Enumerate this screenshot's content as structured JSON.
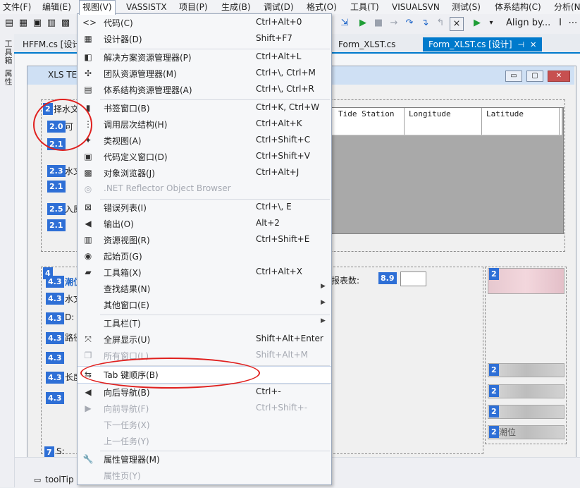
{
  "menubar": {
    "items": [
      "文件(F)",
      "编辑(E)",
      "视图(V)",
      "VASSISTX",
      "项目(P)",
      "生成(B)",
      "调试(D)",
      "格式(O)",
      "工具(T)",
      "VISUALSVN",
      "测试(S)",
      "体系结构(C)",
      "分析(N"
    ]
  },
  "toolbar": {
    "align_label": "Align by...",
    "cursor_glyph": "I"
  },
  "left_strip": {
    "items": [
      "工具箱",
      "属性"
    ]
  },
  "doc_tabs": {
    "items": [
      {
        "label": "HFFM.cs [设计]"
      },
      {
        "label": "Form_XLST.cs"
      },
      {
        "label": "Form_XLST.cs [设计]",
        "pin": "⊣",
        "close": "✕"
      }
    ]
  },
  "form": {
    "title": "XLS TE",
    "window_buttons": {
      "minimize": "▭",
      "maximize": "▢",
      "close": "✕"
    },
    "labels": {
      "l1": "择水文",
      "l2": "可",
      "l3": "水文",
      "l4": "入原",
      "l5": "潮位",
      "l6": "水文",
      "l7": "D:",
      "l8": "路径",
      "l9": "长度",
      "l10": "S:",
      "count_label": "报表数:",
      "lower_btn_text": "潮位"
    },
    "tab_badges": [
      "2",
      "2.0",
      "2.1",
      "2.3",
      "2.1",
      "2.5",
      "2.1",
      "4",
      "4.3",
      "4.3",
      "4.3",
      "4.3",
      "4.3",
      "4.3",
      "4.3",
      "8.9",
      "7",
      "2",
      "2",
      "2",
      "2",
      "2"
    ],
    "grid": {
      "columns": [
        "Tide Station",
        "Longitude",
        "Latitude"
      ]
    },
    "component_tray": {
      "item": "toolTip"
    }
  },
  "view_menu": {
    "items": [
      {
        "icon": "code-icon",
        "glyph": "<>",
        "label": "代码(C)",
        "shortcut": "Ctrl+Alt+0",
        "disabled": false
      },
      {
        "icon": "designer-icon",
        "glyph": "▦",
        "label": "设计器(D)",
        "shortcut": "Shift+F7",
        "disabled": false
      },
      {
        "sep": true
      },
      {
        "icon": "solution-explorer-icon",
        "glyph": "◧",
        "label": "解决方案资源管理器(P)",
        "shortcut": "Ctrl+Alt+L",
        "disabled": false
      },
      {
        "icon": "team-explorer-icon",
        "glyph": "✣",
        "label": "团队资源管理器(M)",
        "shortcut": "Ctrl+\\, Ctrl+M",
        "disabled": false
      },
      {
        "icon": "architecture-explorer-icon",
        "glyph": "▤",
        "label": "体系结构资源管理器(A)",
        "shortcut": "Ctrl+\\, Ctrl+R",
        "disabled": false
      },
      {
        "sep": true
      },
      {
        "icon": "bookmark-icon",
        "glyph": "▮",
        "label": "书签窗口(B)",
        "shortcut": "Ctrl+K, Ctrl+W",
        "disabled": false
      },
      {
        "icon": "call-hierarchy-icon",
        "glyph": "⋮",
        "label": "调用层次结构(H)",
        "shortcut": "Ctrl+Alt+K",
        "disabled": false
      },
      {
        "icon": "class-view-icon",
        "glyph": "✦",
        "label": "类视图(A)",
        "shortcut": "Ctrl+Shift+C",
        "disabled": false
      },
      {
        "icon": "code-definition-icon",
        "glyph": "▣",
        "label": "代码定义窗口(D)",
        "shortcut": "Ctrl+Shift+V",
        "disabled": false
      },
      {
        "icon": "object-browser-icon",
        "glyph": "▩",
        "label": "对象浏览器(J)",
        "shortcut": "Ctrl+Alt+J",
        "disabled": false
      },
      {
        "icon": "reflector-icon",
        "glyph": "◎",
        "label": ".NET Reflector Object Browser",
        "shortcut": "",
        "disabled": true
      },
      {
        "sep": true
      },
      {
        "icon": "error-list-icon",
        "glyph": "⊠",
        "label": "错误列表(I)",
        "shortcut": "Ctrl+\\, E",
        "disabled": false
      },
      {
        "icon": "output-icon",
        "glyph": "◀",
        "label": "输出(O)",
        "shortcut": "Alt+2",
        "disabled": false
      },
      {
        "icon": "resource-view-icon",
        "glyph": "▥",
        "label": "资源视图(R)",
        "shortcut": "Ctrl+Shift+E",
        "disabled": false
      },
      {
        "icon": "start-page-icon",
        "glyph": "◉",
        "label": "起始页(G)",
        "shortcut": "",
        "disabled": false
      },
      {
        "icon": "toolbox-icon",
        "glyph": "▰",
        "label": "工具箱(X)",
        "shortcut": "Ctrl+Alt+X",
        "disabled": false
      },
      {
        "icon": "find-results-icon",
        "glyph": "",
        "label": "查找结果(N)",
        "shortcut": "",
        "disabled": false,
        "submenu": true
      },
      {
        "icon": "other-windows-icon",
        "glyph": "",
        "label": "其他窗口(E)",
        "shortcut": "",
        "disabled": false,
        "submenu": true
      },
      {
        "sep": true
      },
      {
        "icon": "toolbars-icon",
        "glyph": "",
        "label": "工具栏(T)",
        "shortcut": "",
        "disabled": false,
        "submenu": true
      },
      {
        "icon": "full-screen-icon",
        "glyph": "⤧",
        "label": "全屏显示(U)",
        "shortcut": "Shift+Alt+Enter",
        "disabled": false
      },
      {
        "icon": "all-windows-icon",
        "glyph": "❐",
        "label": "所有窗口(L)",
        "shortcut": "Shift+Alt+M",
        "disabled": true
      },
      {
        "sep": true
      },
      {
        "icon": "tab-order-icon",
        "glyph": "⇆",
        "label": "Tab 键顺序(B)",
        "shortcut": "",
        "disabled": false,
        "highlight": true
      },
      {
        "sep": true
      },
      {
        "icon": "navigate-back-icon",
        "glyph": "◀",
        "label": "向后导航(B)",
        "shortcut": "Ctrl+-",
        "disabled": false
      },
      {
        "icon": "navigate-forward-icon",
        "glyph": "▶",
        "label": "向前导航(F)",
        "shortcut": "Ctrl+Shift+-",
        "disabled": true
      },
      {
        "icon": "next-task-icon",
        "glyph": "",
        "label": "下一任务(X)",
        "shortcut": "",
        "disabled": true
      },
      {
        "icon": "previous-task-icon",
        "glyph": "",
        "label": "上一任务(Y)",
        "shortcut": "",
        "disabled": true
      },
      {
        "sep": true
      },
      {
        "icon": "property-manager-icon",
        "glyph": "🔧",
        "label": "属性管理器(M)",
        "shortcut": "",
        "disabled": false
      },
      {
        "icon": "property-pages-icon",
        "glyph": "",
        "label": "属性页(Y)",
        "shortcut": "",
        "disabled": true
      }
    ]
  },
  "colors": {
    "accent": "#007acc",
    "badge": "#2e6fd6",
    "annotation": "#e0201e"
  }
}
